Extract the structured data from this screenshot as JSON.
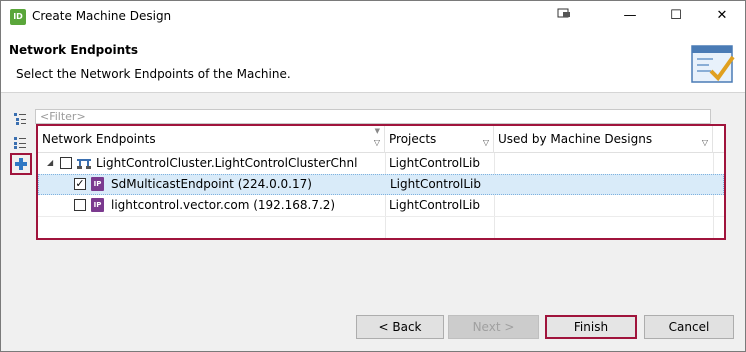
{
  "window": {
    "app_icon_text": "ID",
    "title": "Create Machine Design",
    "controls": {
      "minimize": "—",
      "maximize": "☐",
      "close": "✕"
    }
  },
  "header": {
    "title": "Network Endpoints",
    "description": "Select the Network Endpoints of the Machine."
  },
  "filter": {
    "placeholder": "<Filter>"
  },
  "table": {
    "columns": [
      "Network Endpoints",
      "Projects",
      "Used by Machine Designs"
    ],
    "rows": [
      {
        "name": "LightControlCluster.LightControlClusterChnl",
        "project": "LightControlLib",
        "used_by": "",
        "checked": false,
        "expanded": true,
        "icon": "cluster-channel-icon"
      },
      {
        "name": "SdMulticastEndpoint (224.0.0.17)",
        "project": "LightControlLib",
        "used_by": "",
        "checked": true,
        "icon": "ip-endpoint-icon",
        "ip_label": "IP"
      },
      {
        "name": "lightcontrol.vector.com (192.168.7.2)",
        "project": "LightControlLib",
        "used_by": "",
        "checked": false,
        "icon": "ip-endpoint-icon",
        "ip_label": "IP"
      }
    ]
  },
  "side_tools": [
    "expand-all-icon",
    "collapse-all-icon",
    "add-icon"
  ],
  "buttons": {
    "back": "< Back",
    "next": "Next >",
    "finish": "Finish",
    "cancel": "Cancel"
  },
  "colors": {
    "highlight_border": "#a0143c",
    "selection_bg": "#d9ebf9",
    "ip_icon": "#7b3a8f",
    "app_icon": "#5aa63a"
  }
}
